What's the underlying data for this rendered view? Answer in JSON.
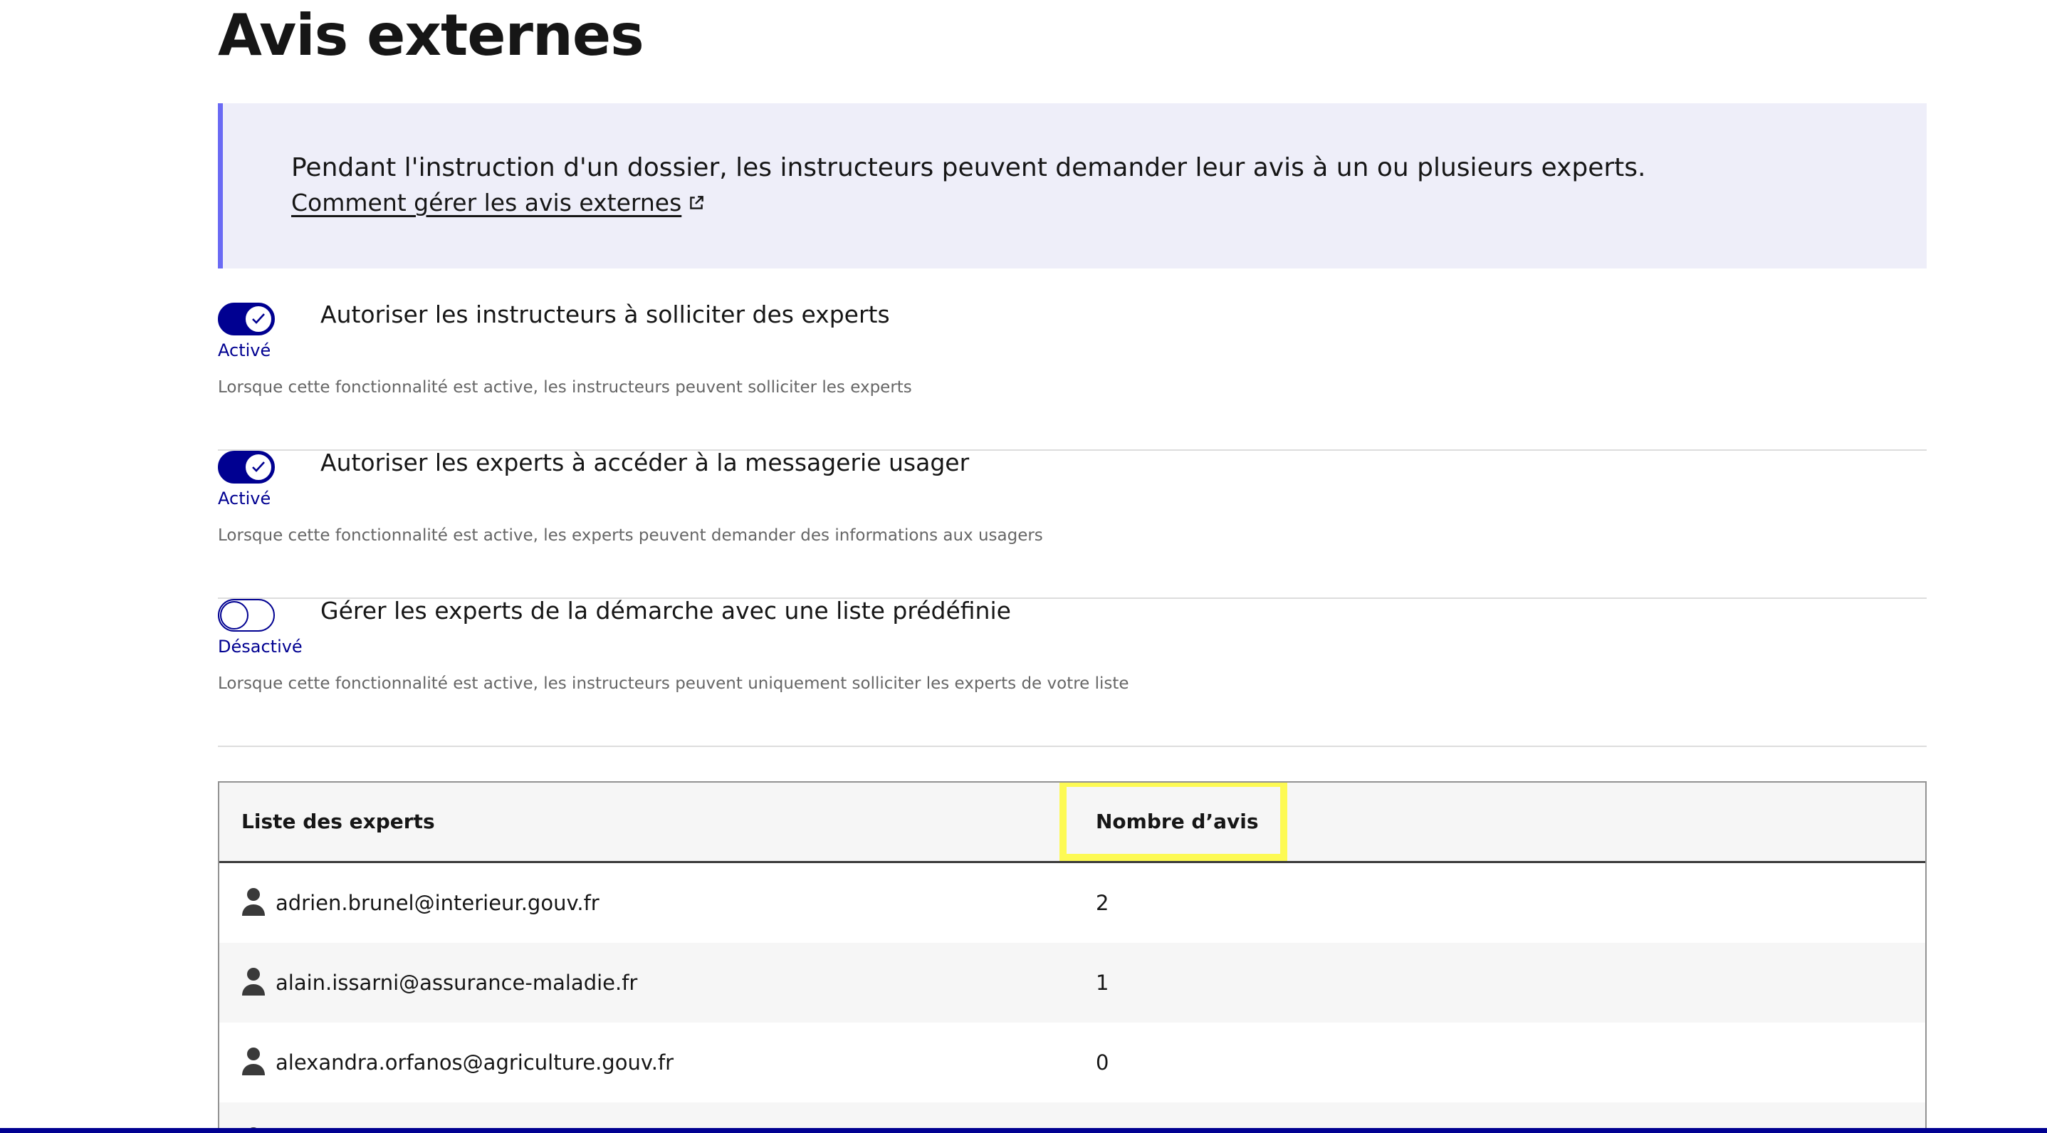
{
  "page": {
    "title": "Avis externes"
  },
  "callout": {
    "text": "Pendant l'instruction d'un dossier, les instructeurs peuvent demander leur avis à un ou plusieurs experts.",
    "link_label": "Comment gérer les avis externes",
    "link_icon": "external-link-icon"
  },
  "toggles": [
    {
      "label": "Autoriser les instructeurs à solliciter des experts",
      "state": "Activé",
      "checked": true,
      "hint": "Lorsque cette fonctionnalité est active, les instructeurs peuvent solliciter les experts"
    },
    {
      "label": "Autoriser les experts à accéder à la messagerie usager",
      "state": "Activé",
      "checked": true,
      "hint": "Lorsque cette fonctionnalité est active, les experts peuvent demander des informations aux usagers"
    },
    {
      "label": "Gérer les experts de la démarche avec une liste prédéfinie",
      "state": "Désactivé",
      "checked": false,
      "hint": "Lorsque cette fonctionnalité est active, les instructeurs peuvent uniquement solliciter les experts de votre liste"
    }
  ],
  "experts_table": {
    "columns": [
      "Liste des experts",
      "Nombre d’avis"
    ],
    "highlighted_column": "Nombre d’avis",
    "highlight_color": "#fdfa54",
    "rows": [
      {
        "email": "adrien.brunel@interieur.gouv.fr",
        "count": "2"
      },
      {
        "email": "alain.issarni@assurance-maladie.fr",
        "count": "1"
      },
      {
        "email": "alexandra.orfanos@agriculture.gouv.fr",
        "count": "0"
      },
      {
        "email": "",
        "count": ""
      }
    ]
  },
  "colors": {
    "brand_blue": "#000091",
    "callout_bg": "#eeeef9",
    "callout_border": "#6a6af4"
  }
}
